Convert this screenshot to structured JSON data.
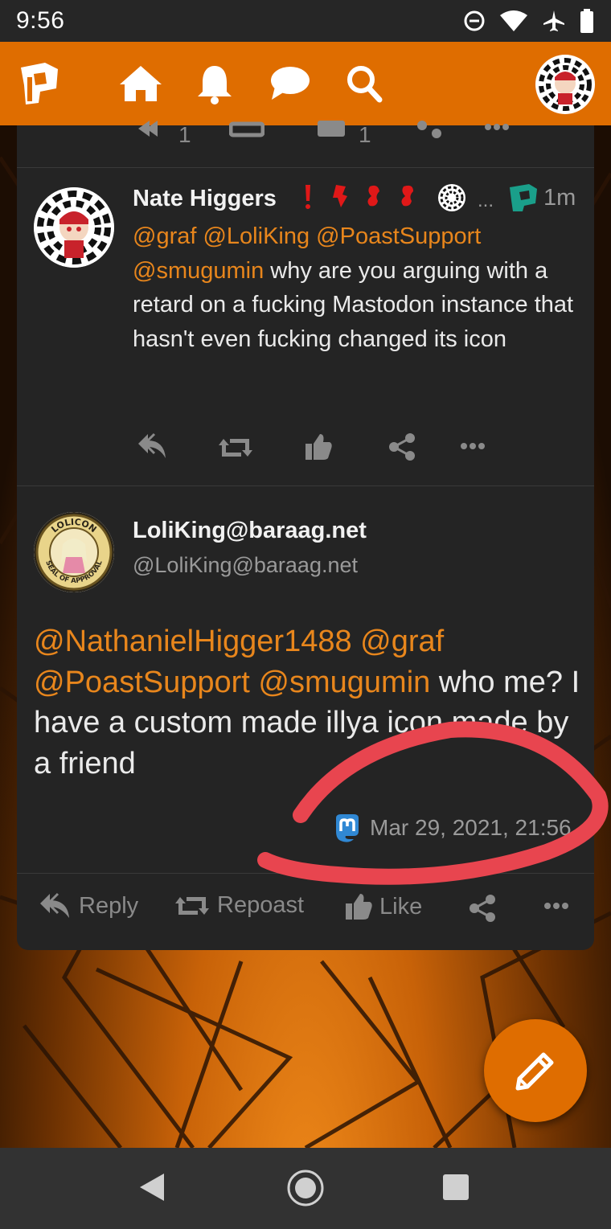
{
  "status_bar": {
    "time": "9:56"
  },
  "nav": {
    "logo": "poast-logo-icon",
    "items": [
      "home-icon",
      "bell-icon",
      "chat-icon",
      "search-icon"
    ]
  },
  "prev_post": {
    "reply_count": "1",
    "like_count": "1"
  },
  "post1": {
    "author": "Nate Higgers",
    "time": "1m",
    "more": "...",
    "mentions": [
      "@graf",
      "@LoliKing",
      "@PoastSupport",
      "@smugumin"
    ],
    "text_line1_tail": " why are you arguing with",
    "text_rest": "a retard on a fucking Mastodon instance that hasn't even fucking changed its icon"
  },
  "post2": {
    "author": "LoliKing@baraag.net",
    "handle": "@LoliKing@baraag.net",
    "avatar_text_top": "LOLICON",
    "avatar_text_bottom": "SEAL OF APPROVAL",
    "mentions": [
      "@NathanielHigger1488",
      "@graf",
      "@PoastSupport",
      "@smugumin"
    ],
    "text_tail": " who me? I have a custom made illya icon made by a friend",
    "timestamp": "Mar 29, 2021, 21:56",
    "actions": {
      "reply": "Reply",
      "repost": "Repoast",
      "like": "Like"
    }
  },
  "colors": {
    "accent": "#df6d00",
    "mention": "#e8861c",
    "card": "#242424",
    "annotation": "#e8454f"
  }
}
